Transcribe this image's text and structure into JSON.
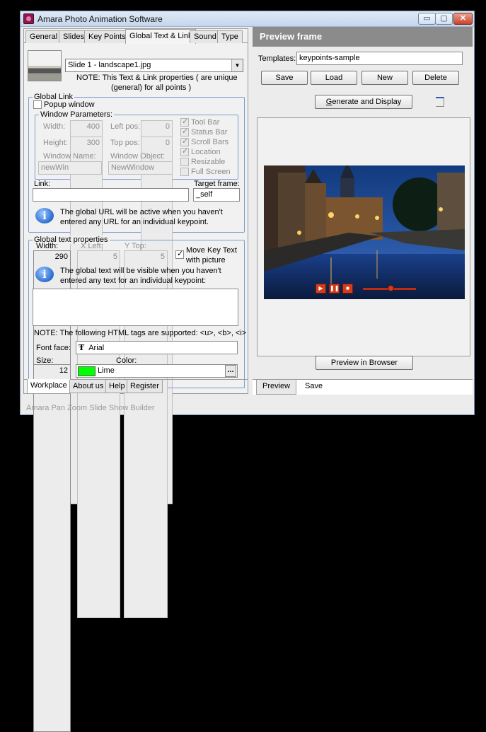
{
  "window": {
    "title": "Amara Photo Animation Software",
    "controls": {
      "minimize": "▭",
      "maximize": "▢",
      "close": "✕"
    }
  },
  "left_tabs": [
    "General",
    "Slides",
    "Key Points",
    "Global Text & Link",
    "Sound",
    "Type"
  ],
  "slide_select": {
    "value": "Slide 1 - landscape1.jpg"
  },
  "note_props": "NOTE: This Text & Link properties ( are unique",
  "note_props2": "(general) for all points )",
  "global_link": {
    "legend": "Global Link",
    "popup_label": "Popup window",
    "window_params_legend": "Window Parameters:",
    "width_label": "Width:",
    "width_value": "400",
    "height_label": "Height:",
    "height_value": "300",
    "left_label": "Left pos:",
    "left_value": "0",
    "top_label": "Top pos:",
    "top_value": "0",
    "window_name_label": "Window Name:",
    "window_name_value": "newWin",
    "window_object_label": "Window Object:",
    "window_object_value": "NewWindow",
    "checks": [
      "Tool Bar",
      "Status Bar",
      "Scroll Bars",
      "Location",
      "Resizable",
      "Full Screen"
    ],
    "link_label": "Link:",
    "link_value": "",
    "target_label": "Target frame:",
    "target_value": "_self",
    "info_line1": "The global URL will be active when you haven't",
    "info_line2": "entered any URL for an individual keypoint."
  },
  "global_text": {
    "legend": "Global text properties",
    "width_label": "Width:",
    "width_value": "290",
    "x_label": "X Left:",
    "x_value": "5",
    "y_label": "Y Top:",
    "y_value": "5",
    "move_label1": "Move Key Text",
    "move_label2": "with picture",
    "info_line1": "The global text will be visible when you haven't",
    "info_line2": "entered any text for an individual keypoint:",
    "html_note": "NOTE: The following HTML tags are supported: <u>, <b>, <i>",
    "font_face_label": "Font face:",
    "font_face_value": "Arial",
    "font_icon": "Ŧ",
    "size_label": "Size:",
    "size_value": "12",
    "color_label": "Color:",
    "color_value": "Lime",
    "color_hex": "#00ff00",
    "more_button": "..."
  },
  "bottom_tabs_left": [
    "Workplace",
    "About us",
    "Help",
    "Register"
  ],
  "status_text": "Amara Pan Zoom Slide Show Builder",
  "preview": {
    "header": "Preview frame",
    "templates_label": "Templates:",
    "templates_value": "keypoints-sample",
    "save_button": "Save",
    "load_button": "Load",
    "new_button": "New",
    "delete_button": "Delete",
    "generate_button_g": "G",
    "generate_button_rest": "enerate and Display",
    "preview_browser_button": "Preview in Browser",
    "bottom_tabs": [
      "Preview",
      "Save"
    ]
  }
}
